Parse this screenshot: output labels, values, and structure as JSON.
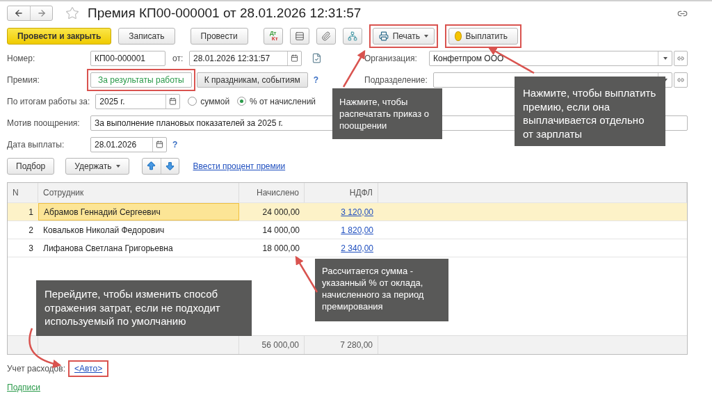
{
  "window": {
    "title": "Премия КП00-000001 от 28.01.2026 12:31:57",
    "favorite": false
  },
  "toolbar": {
    "primary": "Провести и закрыть",
    "buttons": [
      "Записать",
      "Провести"
    ],
    "dt_kt": [
      "Дт",
      "Кт"
    ],
    "print": {
      "label": "Печать",
      "highlighted": true
    },
    "pay": {
      "label": "Выплатить",
      "highlighted": true
    }
  },
  "number": {
    "label": "Номер:",
    "value": "КП00-000001"
  },
  "date": {
    "label": "от:",
    "value": "28.01.2026 12:31:57"
  },
  "organization": {
    "label": "Организация:",
    "value": "Конфетпром ООО"
  },
  "department": {
    "label": "Подразделение:"
  },
  "premium": {
    "label": "Премия:",
    "help": "?",
    "options": [
      {
        "label": "За результаты работы",
        "selected": true,
        "highlighted": true
      },
      {
        "label": "К праздникам, событиям",
        "selected": false,
        "highlighted": false
      }
    ]
  },
  "period": {
    "label": "По итогам работы за:",
    "value": "2025 г.",
    "modes": [
      {
        "label": "суммой",
        "selected": false
      },
      {
        "label": "% от начислений",
        "selected": true
      }
    ]
  },
  "motive": {
    "label": "Мотив поощрения:",
    "value": "За выполнение плановых показателей за 2025 г."
  },
  "pay_date": {
    "label": "Дата выплаты:",
    "value": "28.01.2026",
    "help": "?"
  },
  "table_toolbar": {
    "pick": "Подбор",
    "withhold": "Удержать",
    "link": "Ввести процент премии"
  },
  "table": {
    "columns": [
      "N",
      "Сотрудник",
      "Начислено",
      "НДФЛ"
    ],
    "rows": [
      {
        "n": "1",
        "employee": "Абрамов Геннадий Сергеевич",
        "accrued": "24 000,00",
        "tax": "3 120,00",
        "selected": true
      },
      {
        "n": "2",
        "employee": "Ковальков Николай Федорович",
        "accrued": "14 000,00",
        "tax": "1 820,00",
        "selected": false
      },
      {
        "n": "3",
        "employee": "Лифанова Светлана Григорьевна",
        "accrued": "18 000,00",
        "tax": "2 340,00",
        "selected": false
      }
    ],
    "totals": {
      "accrued": "56 000,00",
      "tax": "7 280,00"
    }
  },
  "expenses": {
    "label": "Учет расходов:",
    "value": "<Авто>",
    "highlighted": true
  },
  "signatures": "Подписи",
  "callouts": [
    {
      "text": "Нажмите, чтобы распечатать приказ о поощрении"
    },
    {
      "text": "Нажмите, чтобы выплатить премию, если она выплачивается отдельно от зарплаты"
    },
    {
      "text": "Рассчитается сумма - указанный % от оклада, начисленного за период премирования"
    },
    {
      "text": "Перейдите, чтобы изменить способ отражения затрат, если не подходит используемый по умолчанию"
    }
  ]
}
